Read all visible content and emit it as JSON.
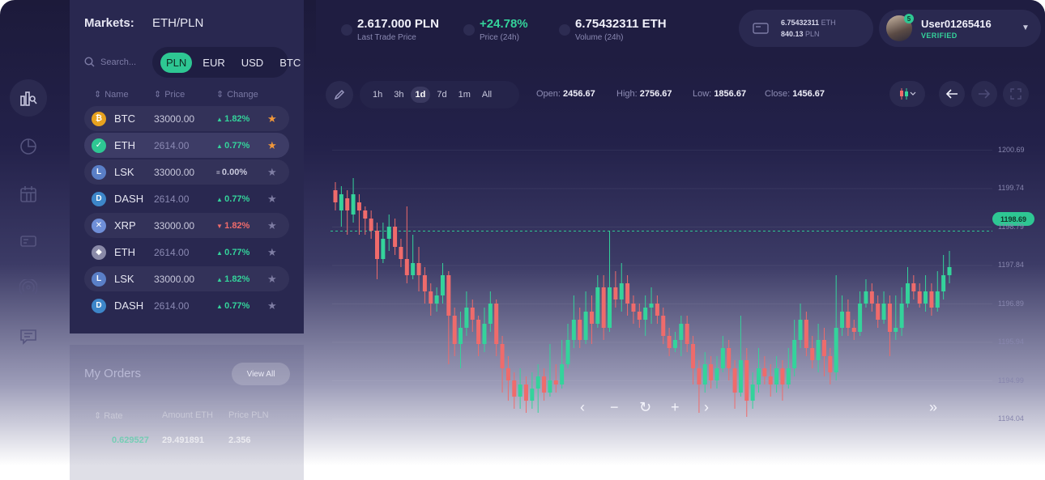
{
  "markets": {
    "title": "Markets:",
    "pair": "ETH/PLN",
    "search_placeholder": "Search...",
    "currencies": [
      "PLN",
      "EUR",
      "USD",
      "BTC"
    ],
    "active_currency": "PLN",
    "columns": [
      "Name",
      "Price",
      "Change"
    ],
    "rows": [
      {
        "icon": "bitcoin-icon",
        "name": "BTC",
        "price": "33000.00",
        "dir": "up",
        "change": "1.82%",
        "starred": true
      },
      {
        "icon": "check-icon",
        "name": "ETH",
        "price": "2614.00",
        "dir": "up",
        "change": "0.77%",
        "starred": true
      },
      {
        "icon": "lisk-icon",
        "name": "LSK",
        "price": "33000.00",
        "dir": "flat",
        "change": "0.00%",
        "starred": false
      },
      {
        "icon": "dash-icon",
        "name": "DASH",
        "price": "2614.00",
        "dir": "up",
        "change": "0.77%",
        "starred": false
      },
      {
        "icon": "ripple-icon",
        "name": "XRP",
        "price": "33000.00",
        "dir": "down",
        "change": "1.82%",
        "starred": false
      },
      {
        "icon": "ethereum-icon",
        "name": "ETH",
        "price": "2614.00",
        "dir": "up",
        "change": "0.77%",
        "starred": false
      },
      {
        "icon": "lisk-icon",
        "name": "LSK",
        "price": "33000.00",
        "dir": "up",
        "change": "1.82%",
        "starred": false
      },
      {
        "icon": "dash-icon",
        "name": "DASH",
        "price": "2614.00",
        "dir": "up",
        "change": "0.77%",
        "starred": false
      }
    ]
  },
  "orders": {
    "title": "My Orders",
    "view_all": "View All",
    "columns": [
      "Rate",
      "Amount ETH",
      "Price PLN"
    ],
    "rows": [
      {
        "rate": "0.629527",
        "amount": "29.491891",
        "price": "2.356"
      }
    ]
  },
  "topbar": {
    "last_trade_value": "2.617.000 PLN",
    "last_trade_label": "Last Trade Price",
    "price_change_value": "+24.78%",
    "price_change_label": "Price (24h)",
    "volume_value": "6.75432311 ETH",
    "volume_label": "Volume (24h)",
    "wallet_eth_amount": "6.75432311",
    "wallet_eth_unit": "ETH",
    "wallet_pln_amount": "840.13",
    "wallet_pln_unit": "PLN"
  },
  "user": {
    "name": "User01265416",
    "status": "VERIFIED",
    "notification_count": "5"
  },
  "chart_toolbar": {
    "timeframes": [
      "1h",
      "3h",
      "1d",
      "7d",
      "1m",
      "All"
    ],
    "active_timeframe": "1d",
    "open_label": "Open:",
    "open_value": "2456.67",
    "high_label": "High:",
    "high_value": "2756.67",
    "low_label": "Low:",
    "low_value": "1856.67",
    "close_label": "Close:",
    "close_value": "1456.67"
  },
  "colors": {
    "up": "#34d39b",
    "down": "#ef6b6b",
    "accent": "#2ec793",
    "star": "#f0973a"
  },
  "chart_data": {
    "type": "candlestick",
    "current_price": "1198.69",
    "y_tick_labels": [
      "1200.69",
      "1199.74",
      "1198.79",
      "1197.84",
      "1196.89",
      "1195.94",
      "1194.99",
      "1194.04"
    ],
    "yticks": [
      1200.69,
      1199.74,
      1198.79,
      1197.84,
      1196.89,
      1195.94,
      1194.99,
      1194.04
    ],
    "current_value": 1198.69,
    "ylim": [
      1193.2,
      1201.6
    ],
    "candles": [
      [
        1199.7,
        1199.4,
        1199.9,
        1199.2
      ],
      [
        1199.2,
        1199.6,
        1199.8,
        1198.8
      ],
      [
        1199.5,
        1199.2,
        1199.7,
        1198.6
      ],
      [
        1199.1,
        1199.6,
        1200.0,
        1198.9
      ],
      [
        1199.4,
        1199.2,
        1199.6,
        1198.6
      ],
      [
        1199.2,
        1199.0,
        1199.3,
        1198.6
      ],
      [
        1199.0,
        1198.7,
        1199.2,
        1198.5
      ],
      [
        1198.7,
        1198.0,
        1198.9,
        1197.5
      ],
      [
        1198.0,
        1198.5,
        1198.9,
        1197.9
      ],
      [
        1198.5,
        1198.8,
        1199.1,
        1198.2
      ],
      [
        1198.8,
        1198.3,
        1199.0,
        1198.1
      ],
      [
        1198.3,
        1198.0,
        1198.5,
        1197.8
      ],
      [
        1198.0,
        1197.6,
        1199.3,
        1197.4
      ],
      [
        1197.6,
        1197.9,
        1198.6,
        1197.5
      ],
      [
        1197.9,
        1197.6,
        1198.3,
        1197.2
      ],
      [
        1197.6,
        1197.2,
        1197.8,
        1196.9
      ],
      [
        1197.2,
        1196.9,
        1197.4,
        1196.6
      ],
      [
        1196.9,
        1197.1,
        1197.3,
        1196.7
      ],
      [
        1197.1,
        1197.6,
        1197.9,
        1196.9
      ],
      [
        1197.6,
        1196.6,
        1197.7,
        1195.4
      ],
      [
        1196.6,
        1195.9,
        1196.8,
        1195.6
      ],
      [
        1195.9,
        1196.3,
        1196.7,
        1195.3
      ],
      [
        1196.3,
        1196.8,
        1197.2,
        1196.1
      ],
      [
        1196.8,
        1196.5,
        1197.0,
        1196.2
      ],
      [
        1196.5,
        1195.9,
        1196.6,
        1195.6
      ],
      [
        1195.9,
        1196.4,
        1196.8,
        1195.7
      ],
      [
        1196.4,
        1196.9,
        1197.2,
        1196.2
      ],
      [
        1196.9,
        1195.9,
        1197.0,
        1195.6
      ],
      [
        1195.9,
        1195.3,
        1196.1,
        1194.7
      ],
      [
        1195.3,
        1195.0,
        1195.6,
        1194.5
      ],
      [
        1195.0,
        1194.6,
        1195.2,
        1194.3
      ],
      [
        1194.6,
        1194.9,
        1195.3,
        1194.3
      ],
      [
        1194.9,
        1194.5,
        1195.1,
        1194.2
      ],
      [
        1194.5,
        1194.8,
        1195.2,
        1194.3
      ],
      [
        1194.8,
        1195.1,
        1195.4,
        1194.2
      ],
      [
        1195.1,
        1194.7,
        1195.3,
        1194.5
      ],
      [
        1194.7,
        1195.0,
        1195.9,
        1194.6
      ],
      [
        1195.0,
        1194.9,
        1195.4,
        1194.7
      ],
      [
        1194.9,
        1195.4,
        1196.0,
        1194.8
      ],
      [
        1195.4,
        1196.0,
        1196.4,
        1195.3
      ],
      [
        1196.0,
        1196.5,
        1197.1,
        1195.8
      ],
      [
        1196.5,
        1196.0,
        1196.8,
        1195.8
      ],
      [
        1196.0,
        1196.7,
        1197.2,
        1195.9
      ],
      [
        1196.7,
        1196.4,
        1197.1,
        1195.9
      ],
      [
        1196.4,
        1197.3,
        1197.6,
        1196.3
      ],
      [
        1197.3,
        1196.3,
        1197.6,
        1196.0
      ],
      [
        1196.3,
        1197.3,
        1198.7,
        1196.2
      ],
      [
        1197.3,
        1197.0,
        1197.7,
        1196.8
      ],
      [
        1197.0,
        1197.4,
        1197.9,
        1196.7
      ],
      [
        1197.4,
        1196.9,
        1197.6,
        1196.6
      ],
      [
        1196.9,
        1196.7,
        1197.1,
        1196.4
      ],
      [
        1196.7,
        1196.5,
        1196.9,
        1196.3
      ],
      [
        1196.5,
        1196.8,
        1197.1,
        1196.1
      ],
      [
        1196.8,
        1196.9,
        1197.3,
        1196.4
      ],
      [
        1196.9,
        1196.6,
        1197.1,
        1196.4
      ],
      [
        1196.6,
        1196.1,
        1196.8,
        1195.9
      ],
      [
        1196.1,
        1195.8,
        1196.3,
        1195.6
      ],
      [
        1195.8,
        1196.0,
        1196.2,
        1195.7
      ],
      [
        1196.0,
        1196.4,
        1196.6,
        1195.6
      ],
      [
        1196.4,
        1195.9,
        1196.6,
        1195.7
      ],
      [
        1195.9,
        1195.3,
        1196.1,
        1194.9
      ],
      [
        1195.3,
        1194.9,
        1195.5,
        1194.2
      ],
      [
        1194.9,
        1195.4,
        1195.7,
        1194.7
      ],
      [
        1195.4,
        1195.0,
        1195.6,
        1194.8
      ],
      [
        1195.0,
        1195.3,
        1195.6,
        1194.8
      ],
      [
        1195.3,
        1195.8,
        1196.1,
        1195.2
      ],
      [
        1195.8,
        1195.3,
        1196.0,
        1195.0
      ],
      [
        1195.3,
        1194.7,
        1195.5,
        1194.3
      ],
      [
        1194.7,
        1195.5,
        1196.6,
        1194.6
      ],
      [
        1195.5,
        1194.5,
        1195.8,
        1194.1
      ],
      [
        1194.5,
        1194.9,
        1195.2,
        1194.3
      ],
      [
        1194.9,
        1195.3,
        1195.8,
        1194.7
      ],
      [
        1195.3,
        1195.1,
        1195.6,
        1194.9
      ],
      [
        1195.1,
        1194.9,
        1195.4,
        1194.6
      ],
      [
        1194.9,
        1195.3,
        1195.6,
        1194.7
      ],
      [
        1195.3,
        1194.9,
        1195.5,
        1194.5
      ],
      [
        1194.9,
        1195.3,
        1195.8,
        1194.8
      ],
      [
        1195.3,
        1196.0,
        1196.5,
        1195.1
      ],
      [
        1196.0,
        1196.5,
        1196.9,
        1195.8
      ],
      [
        1196.5,
        1195.8,
        1196.7,
        1195.6
      ],
      [
        1195.8,
        1195.5,
        1196.1,
        1195.3
      ],
      [
        1195.5,
        1196.0,
        1196.4,
        1195.2
      ],
      [
        1196.0,
        1195.6,
        1196.3,
        1195.1
      ],
      [
        1195.6,
        1195.2,
        1195.8,
        1194.9
      ],
      [
        1195.2,
        1196.3,
        1197.6,
        1195.0
      ],
      [
        1196.3,
        1196.7,
        1197.1,
        1196.1
      ],
      [
        1196.7,
        1196.3,
        1197.0,
        1196.1
      ],
      [
        1196.3,
        1196.2,
        1196.5,
        1196.0
      ],
      [
        1196.2,
        1196.9,
        1197.2,
        1196.1
      ],
      [
        1196.9,
        1197.2,
        1197.5,
        1196.8
      ],
      [
        1197.2,
        1196.9,
        1197.4,
        1196.7
      ],
      [
        1196.9,
        1196.5,
        1197.1,
        1196.3
      ],
      [
        1196.5,
        1196.9,
        1197.2,
        1196.4
      ],
      [
        1196.9,
        1196.2,
        1197.1,
        1195.6
      ],
      [
        1196.2,
        1196.3,
        1197.1,
        1196.0
      ],
      [
        1196.3,
        1196.9,
        1197.3,
        1196.1
      ],
      [
        1196.9,
        1197.4,
        1197.8,
        1196.8
      ],
      [
        1197.4,
        1197.2,
        1197.6,
        1197.0
      ],
      [
        1197.2,
        1196.9,
        1197.4,
        1196.8
      ],
      [
        1196.9,
        1197.2,
        1197.6,
        1196.7
      ],
      [
        1197.2,
        1196.8,
        1197.4,
        1196.6
      ],
      [
        1196.8,
        1197.2,
        1197.7,
        1196.7
      ],
      [
        1197.2,
        1197.6,
        1198.1,
        1197.0
      ],
      [
        1197.6,
        1197.8,
        1198.2,
        1197.4
      ]
    ]
  }
}
